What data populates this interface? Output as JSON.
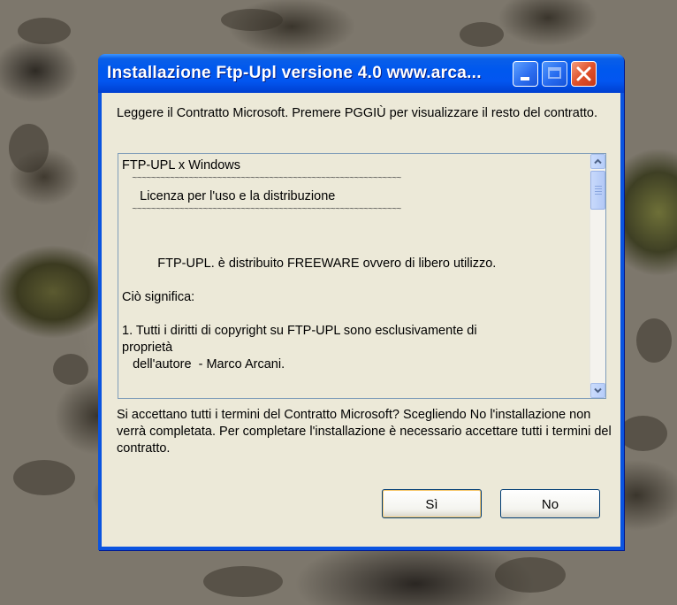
{
  "window": {
    "title": "Installazione Ftp-Upl versione 4.0  www.arca...",
    "controls": {
      "minimize_icon": "minimize-icon",
      "maximize_icon": "maximize-icon",
      "close_icon": "close-icon"
    }
  },
  "dialog": {
    "intro": "Leggere il Contratto Microsoft. Premere PGGIÙ per visualizzare il resto del contratto.",
    "license_lines": [
      "FTP-UPL x Windows",
      "     ~~~~~~~~~~~~~~~~~~~~~~~~~~~~~~~~~~~~~~~~~~~~~~~~~~~~~~~~~",
      "     Licenza per l'uso e la distribuzione",
      "     ~~~~~~~~~~~~~~~~~~~~~~~~~~~~~~~~~~~~~~~~~~~~~~~~~~~~~~~~~",
      "",
      "",
      "          FTP-UPL. è distribuito FREEWARE ovvero di libero utilizzo.",
      "",
      "Ciò significa:",
      "",
      "1. Tutti i diritti di copyright su FTP-UPL sono esclusivamente di",
      "proprietà",
      "   dell'autore  - Marco Arcani."
    ],
    "question": "Si accettano tutti i termini del Contratto Microsoft? Scegliendo No l'installazione non verrà completata. Per completare l'installazione è necessario accettare tutti i termini del contratto.",
    "yes_label": "Sì",
    "no_label": "No"
  },
  "colors": {
    "titlebar": "#0058ee",
    "dialog_bg": "#ece9d8",
    "close_button": "#e0522c"
  }
}
